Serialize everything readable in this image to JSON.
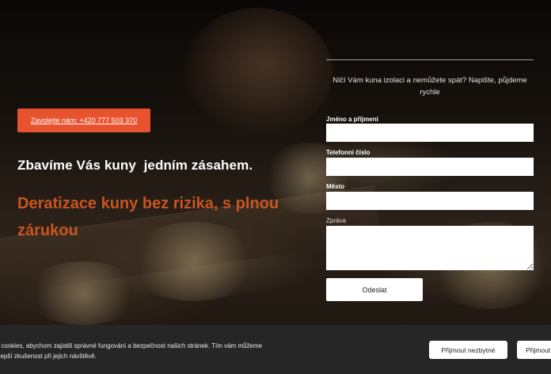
{
  "hero": {
    "call_button": "Zavolejte nám: +420 777 503 370",
    "headline": "Zbavíme Vás kuny  jedním zásahem.",
    "subheadline": "Deratizace kuny bez rizika, s plnou zárukou",
    "accent_color": "#e8532f"
  },
  "form": {
    "intro": "Ničí Vám kuna izolaci a nemůžete spát? Napište, půjdeme rychle",
    "fields": [
      {
        "label": "Jméno a příjmení",
        "value": ""
      },
      {
        "label": "Telefonní číslo",
        "value": ""
      },
      {
        "label": "Město",
        "value": ""
      },
      {
        "label": "Zpráva",
        "value": ""
      }
    ],
    "submit_label": "Odeslat"
  },
  "cookie": {
    "text": "me cookies, abychom zajistili správné fungování a bezpečnost našich stránek. Tím vám můžeme nejlepší zkušenost při jejich návštěvě.",
    "accept_necessary": "Přijmout nezbytné",
    "accept_all": "Přijmout"
  }
}
